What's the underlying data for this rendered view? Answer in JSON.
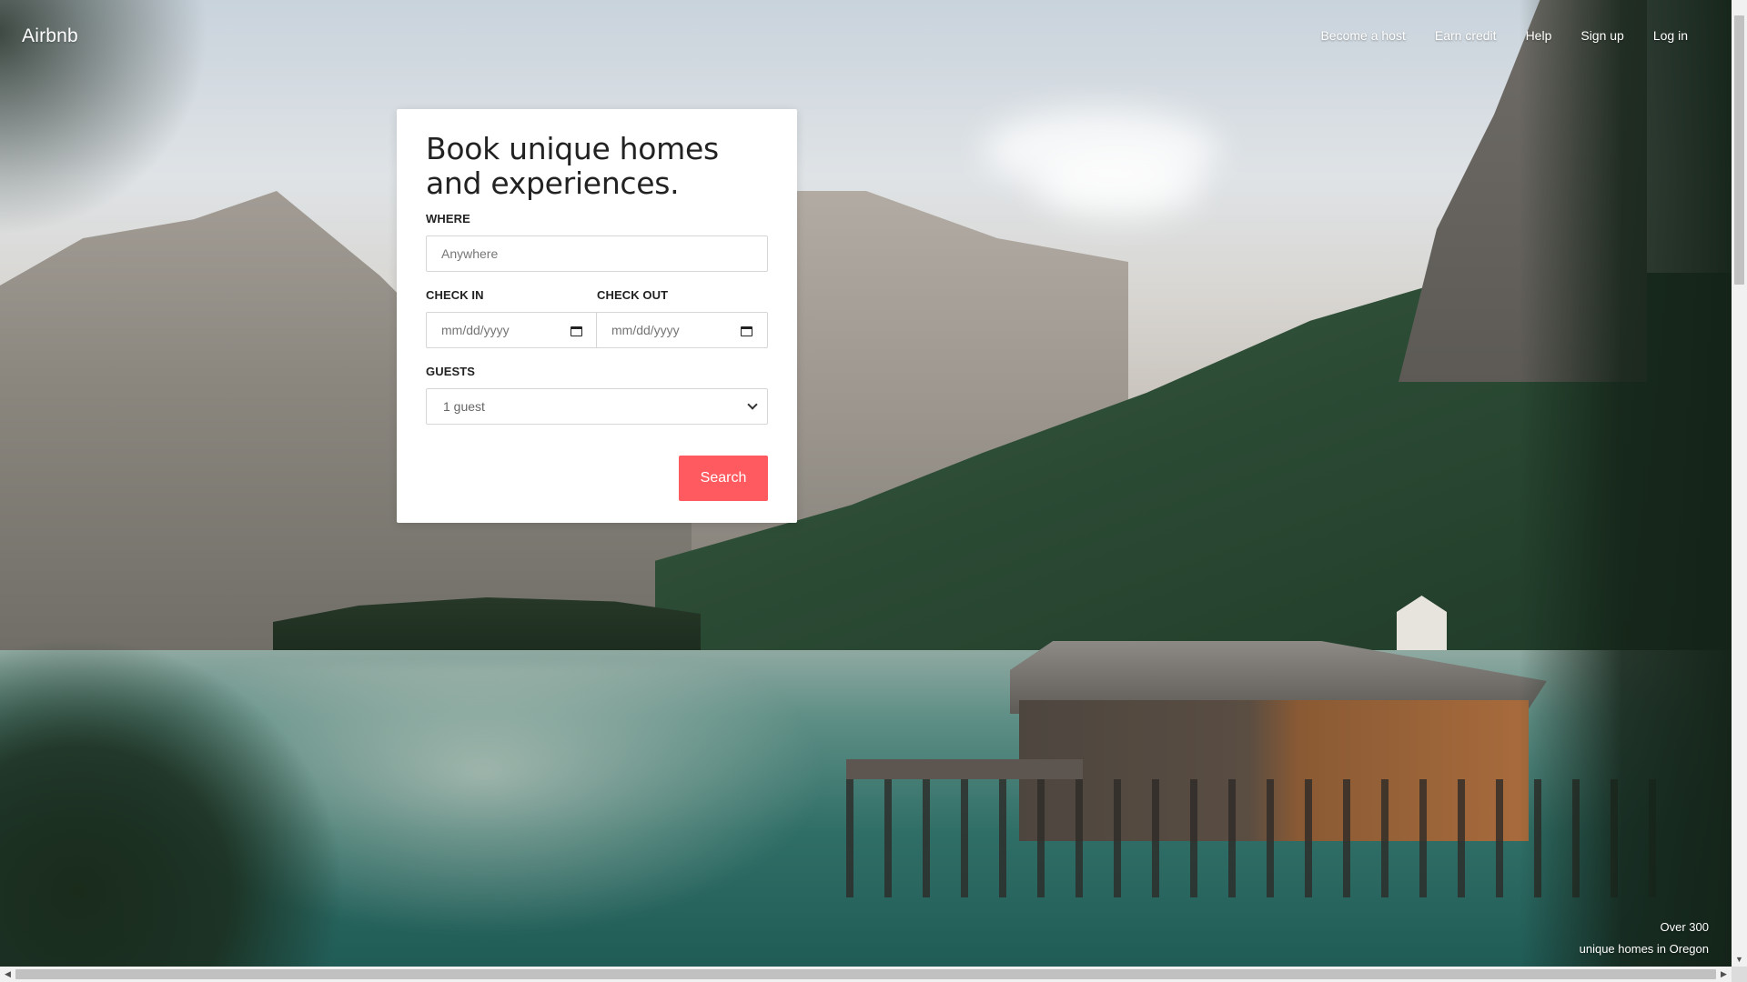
{
  "nav": {
    "brand": "Airbnb",
    "links": [
      "Become a host",
      "Earn credit",
      "Help",
      "Sign up",
      "Log in"
    ]
  },
  "search_card": {
    "title": "Book unique homes and experiences.",
    "where": {
      "label": "WHERE",
      "placeholder": "Anywhere"
    },
    "check_in": {
      "label": "CHECK IN",
      "placeholder": "mm/dd/yyyy"
    },
    "check_out": {
      "label": "CHECK OUT",
      "placeholder": "mm/dd/yyyy"
    },
    "guests": {
      "label": "GUESTS",
      "selected": "1 guest"
    },
    "search_button": "Search",
    "accent_color": "#ff5a5f"
  },
  "caption": {
    "line1": "Over 300",
    "line2": "unique homes in Oregon"
  },
  "icons": {
    "calendar": "calendar-icon",
    "dropdown": "chevron-down-icon"
  }
}
